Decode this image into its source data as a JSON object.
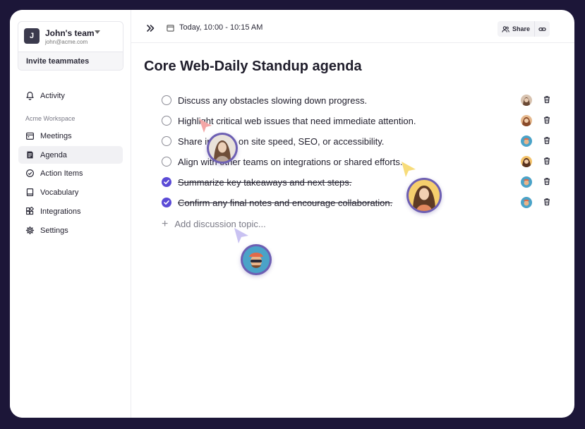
{
  "team": {
    "initial": "J",
    "name": "John's team",
    "email": "john@acme.com",
    "invite_label": "Invite teammates"
  },
  "sidebar": {
    "activity_label": "Activity",
    "workspace_label": "Acme Workspace",
    "items": [
      {
        "label": "Meetings",
        "icon": "calendar-icon"
      },
      {
        "label": "Agenda",
        "icon": "agenda-icon",
        "active": true
      },
      {
        "label": "Action Items",
        "icon": "check-circle-icon"
      },
      {
        "label": "Vocabulary",
        "icon": "book-icon"
      },
      {
        "label": "Integrations",
        "icon": "blocks-icon"
      },
      {
        "label": "Settings",
        "icon": "gear-icon"
      }
    ]
  },
  "topbar": {
    "date": "Today, 10:00 - 10:15 AM",
    "share_label": "Share"
  },
  "page": {
    "title": "Core Web-Daily Standup agenda",
    "add_topic_placeholder": "Add discussion topic..."
  },
  "agenda": [
    {
      "text": "Discuss any obstacles slowing down progress.",
      "done": false
    },
    {
      "text": "Highlight critical web issues that need immediate attention.",
      "done": false
    },
    {
      "text": "Share insights on site speed, SEO, or accessibility.",
      "done": false
    },
    {
      "text": "Align with other teams on integrations or shared efforts.",
      "done": false
    },
    {
      "text": "Summarize key takeaways and next steps.",
      "done": true
    },
    {
      "text": "Confirm any final notes and encourage collaboration.",
      "done": true
    }
  ],
  "colors": {
    "accent": "#5b4bd6",
    "frame": "#1c1638",
    "cursor_ring": "#6d5fb3",
    "pointer_pink": "#f4a6a6",
    "pointer_yellow": "#f7dc7a",
    "pointer_lavender": "#c9c2f2"
  }
}
